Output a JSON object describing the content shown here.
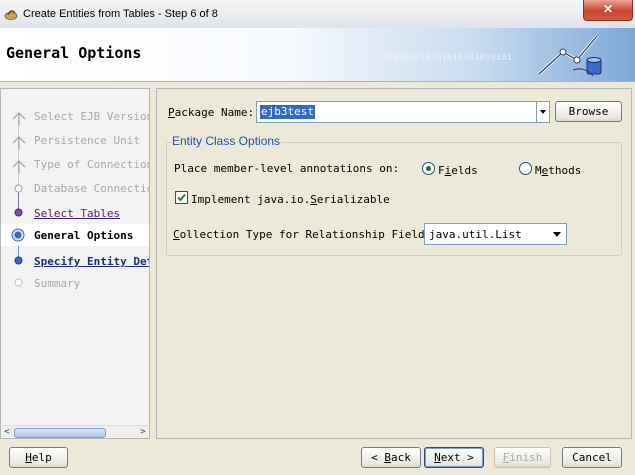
{
  "window": {
    "title": "Create Entities from Tables - Step 6 of 8",
    "close_glyph": "✕"
  },
  "header": {
    "title": "General Options",
    "binary_text": "010101010101010101010101"
  },
  "steps": [
    {
      "label": "Select EJB Version",
      "state": "done"
    },
    {
      "label": "Persistence Unit",
      "state": "done"
    },
    {
      "label": "Type of Connection",
      "state": "done"
    },
    {
      "label": "Database Connection",
      "state": "done"
    },
    {
      "label": "Select Tables",
      "state": "link"
    },
    {
      "label": "General Options",
      "state": "current"
    },
    {
      "label": "Specify Entity Deta",
      "state": "link"
    },
    {
      "label": "Summary",
      "state": "future"
    }
  ],
  "form": {
    "package_label_accel": "P",
    "package_label_rest": "ackage Name:",
    "package_value": "ejb3test",
    "browse_label": "Browse",
    "group_title": "Entity Class Options",
    "annotations_label": "Place member-level annotations on:",
    "fields_accel": "i",
    "fields_pre": "F",
    "fields_post": "elds",
    "methods_accel": "e",
    "methods_pre": "M",
    "methods_post": "thods",
    "annotation_choice": "Fields",
    "serializable_pre": "Implement java.io.",
    "serializable_accel": "S",
    "serializable_post": "erializable",
    "serializable_checked": true,
    "collection_pre": "",
    "collection_accel": "C",
    "collection_post": "ollection Type for Relationship Fields:",
    "collection_value": "java.util.List"
  },
  "footer": {
    "help_accel": "H",
    "help_rest": "elp",
    "back_glyph": "<",
    "back_accel": "B",
    "back_rest": "ack",
    "next_accel": "N",
    "next_rest": "ext",
    "next_glyph": ">",
    "finish_accel": "F",
    "finish_rest": "inish",
    "cancel_label": "Cancel"
  },
  "colors": {
    "accent": "#316ac5",
    "group_title": "#1c52a8",
    "step_link_visited": "#4b1e74"
  }
}
